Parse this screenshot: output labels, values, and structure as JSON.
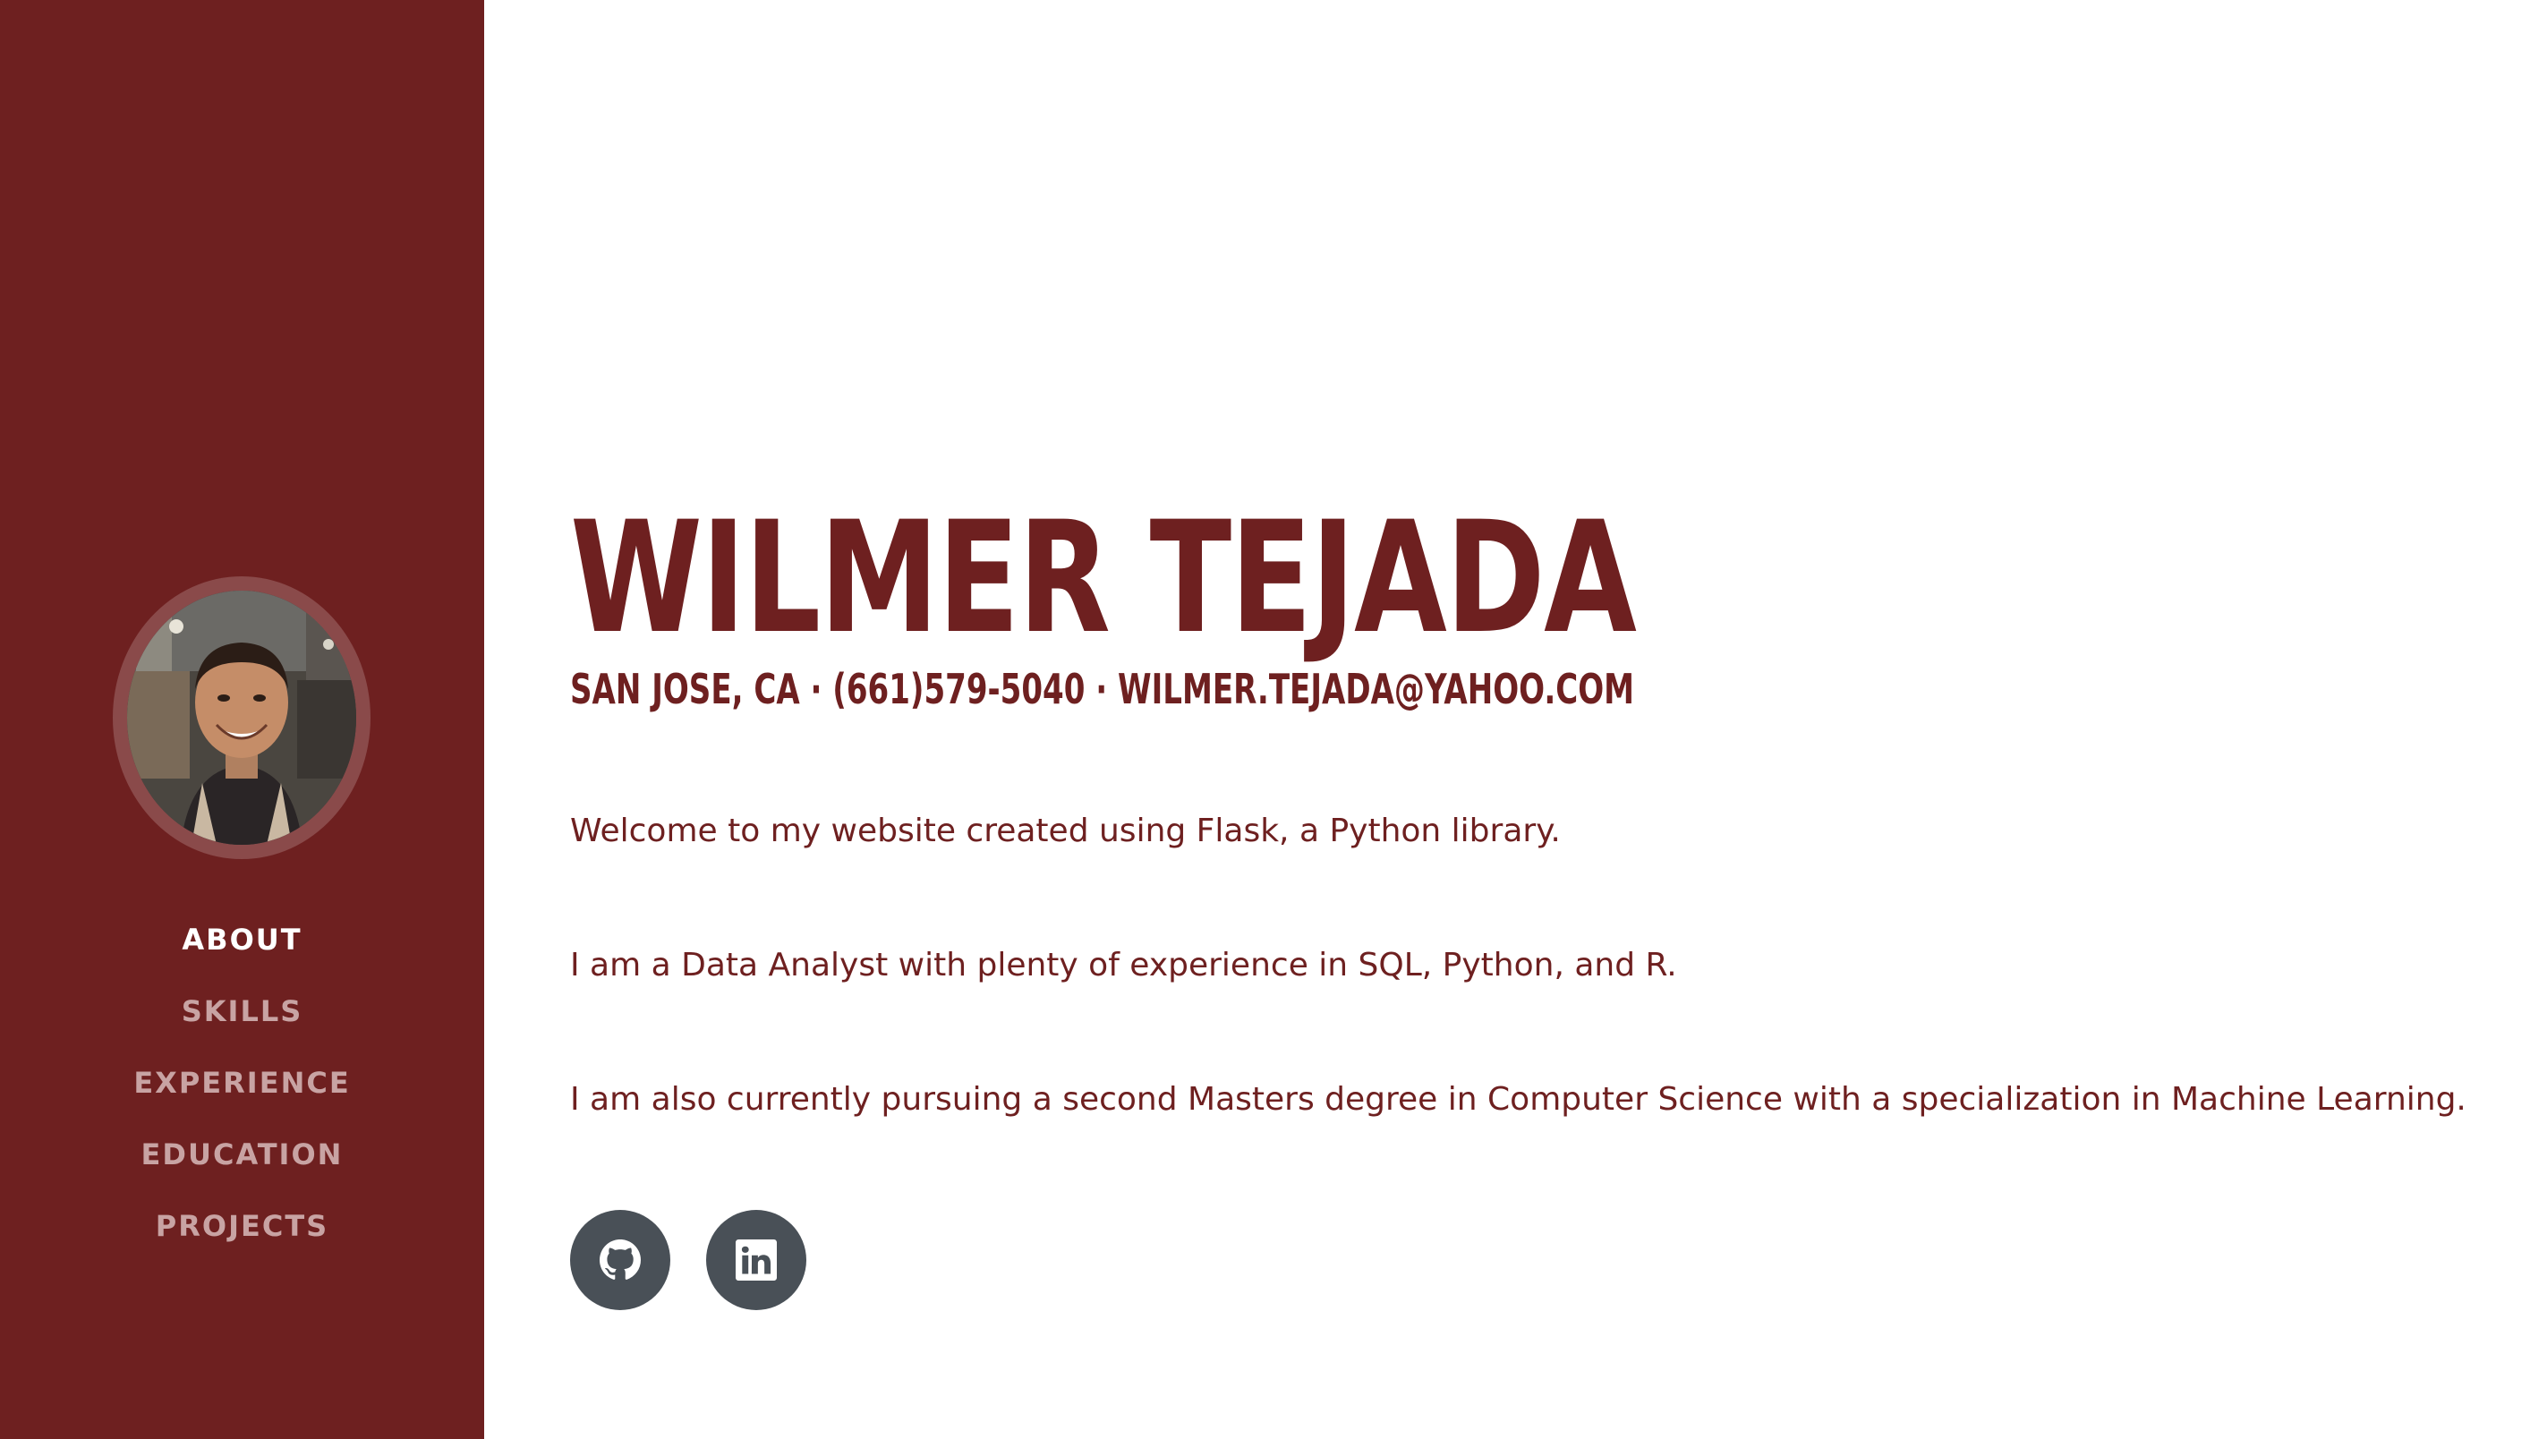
{
  "sidebar": {
    "avatar_alt": "profile photo",
    "nav": [
      {
        "label": "ABOUT",
        "active": true
      },
      {
        "label": "SKILLS",
        "active": false
      },
      {
        "label": "EXPERIENCE",
        "active": false
      },
      {
        "label": "EDUCATION",
        "active": false
      },
      {
        "label": "PROJECTS",
        "active": false
      }
    ]
  },
  "main": {
    "name": "WILMER TEJADA",
    "contact": "SAN JOSE, CA · (661)579-5040 · WILMER.TEJADA@YAHOO.COM",
    "paragraphs": [
      "Welcome to my website created using Flask, a Python library.",
      "I am a Data Analyst with plenty of experience in SQL, Python, and R.",
      "I am also currently pursuing a second Masters degree in Computer Science with a specialization in Machine Learning."
    ],
    "socials": [
      {
        "icon": "github-icon"
      },
      {
        "icon": "linkedin-icon"
      }
    ]
  },
  "colors": {
    "primary": "#6e2020",
    "nav_inactive": "#c8a3a3",
    "nav_active": "#ffffff",
    "social_bg": "#495057"
  }
}
